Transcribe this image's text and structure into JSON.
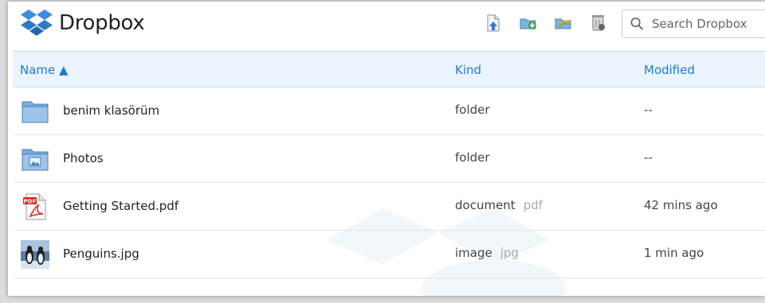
{
  "app": {
    "title": "Dropbox"
  },
  "toolbar": {
    "buttons": [
      {
        "icon": "upload-icon"
      },
      {
        "icon": "new-folder-icon"
      },
      {
        "icon": "shared-folder-icon"
      },
      {
        "icon": "deleted-files-icon"
      }
    ]
  },
  "search": {
    "placeholder": "Search Dropbox",
    "value": ""
  },
  "columns": {
    "name": "Name ▲",
    "kind": "Kind",
    "modified": "Modified"
  },
  "files": [
    {
      "name": "benim klasörüm",
      "kind": "folder",
      "ext": "",
      "modified": "--",
      "icon": "folder-icon"
    },
    {
      "name": "Photos",
      "kind": "folder",
      "ext": "",
      "modified": "--",
      "icon": "photos-folder-icon"
    },
    {
      "name": "Getting Started.pdf",
      "kind": "document",
      "ext": "pdf",
      "modified": "42 mins ago",
      "icon": "pdf-icon"
    },
    {
      "name": "Penguins.jpg",
      "kind": "image",
      "ext": "jpg",
      "modified": "1 min ago",
      "icon": "image-thumbnail"
    }
  ],
  "colors": {
    "accent": "#1f7acd",
    "header_bg": "#eaf4fc"
  }
}
